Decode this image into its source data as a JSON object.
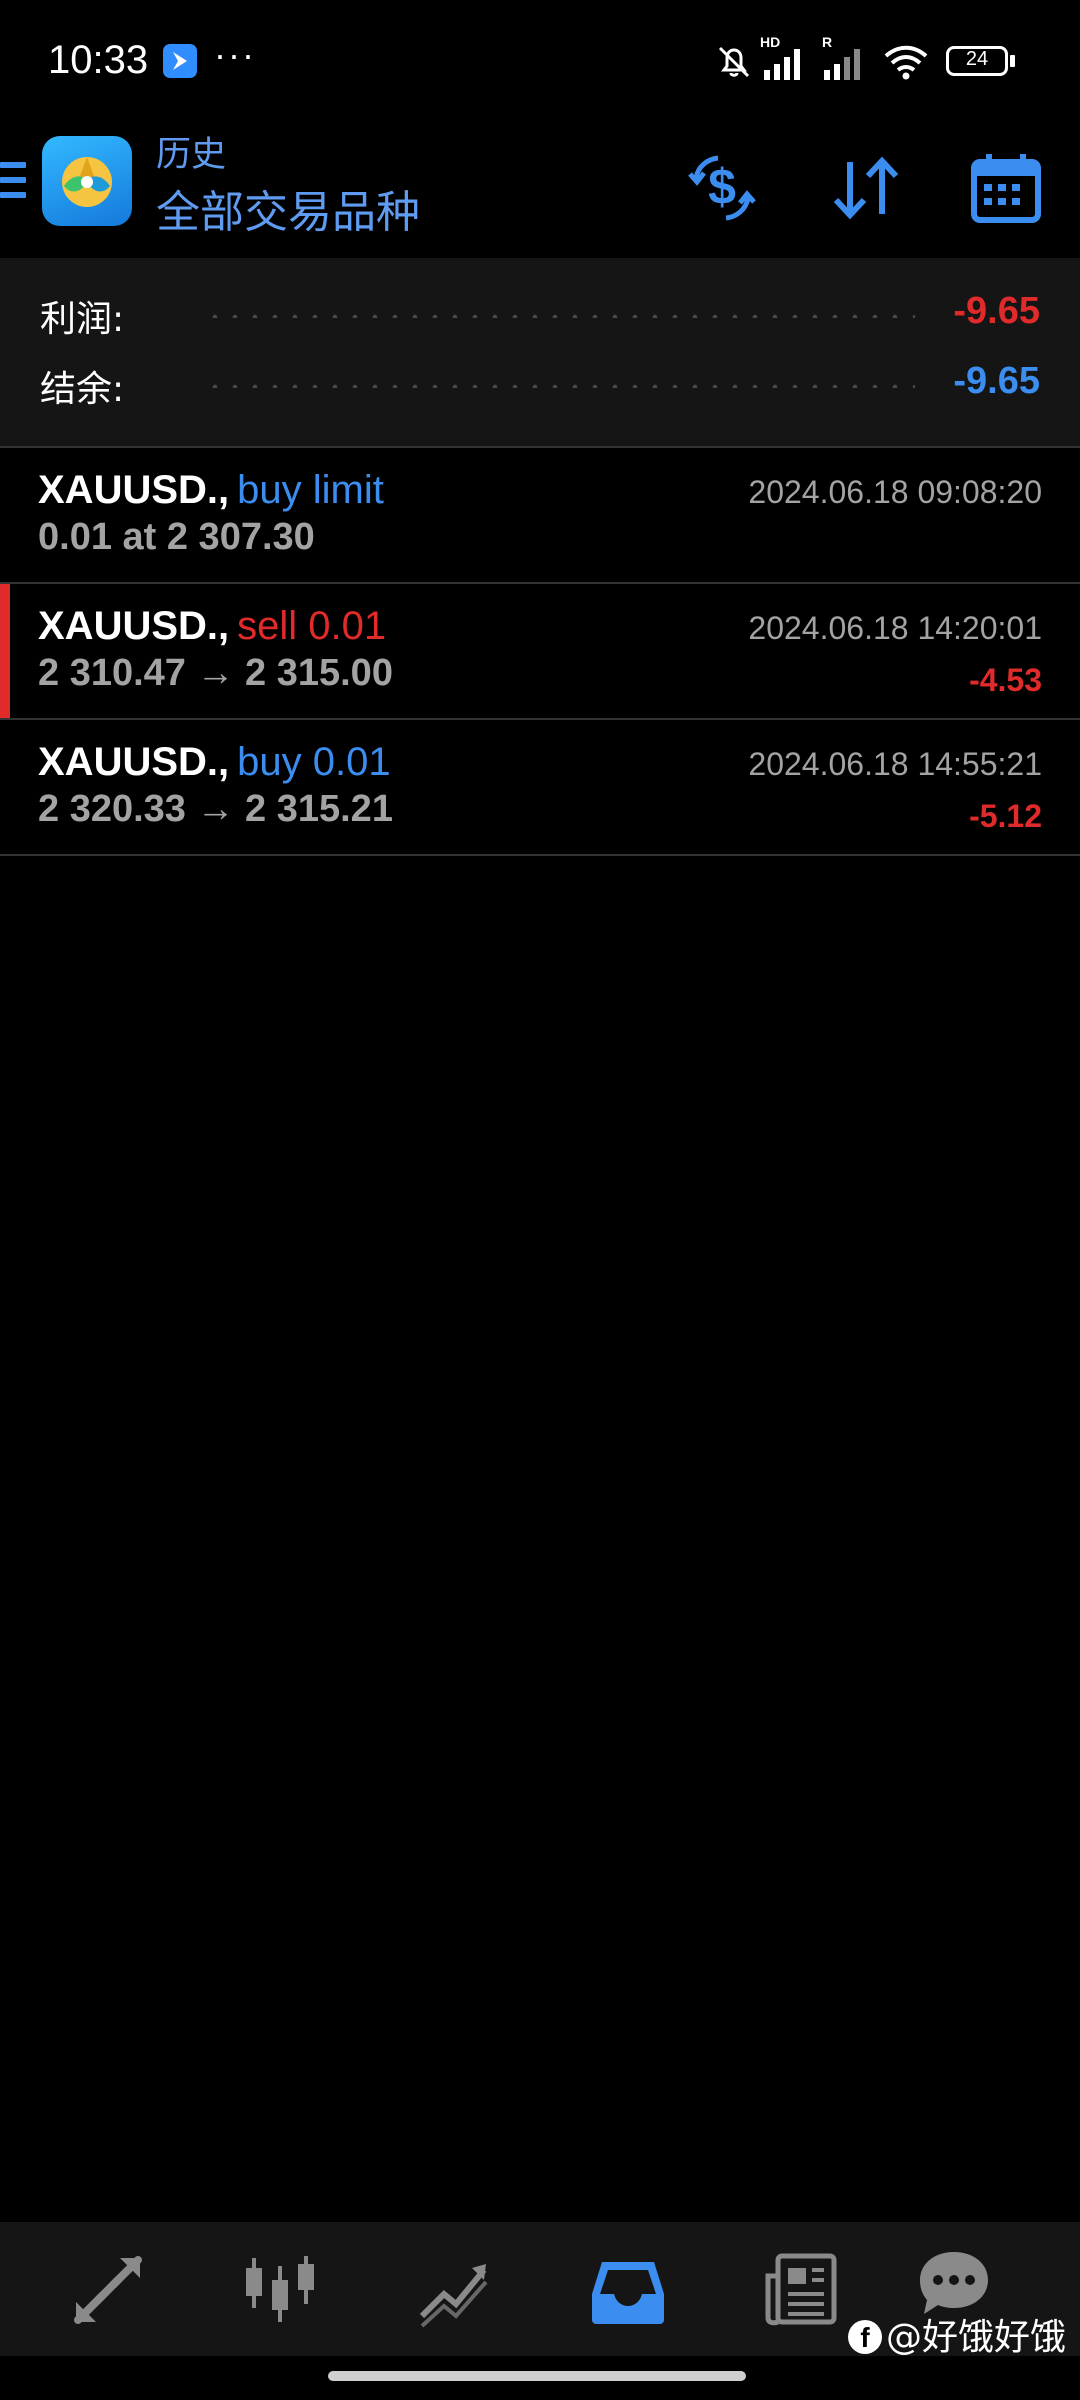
{
  "status_bar": {
    "time": "10:33",
    "more": "···",
    "network_hd": "HD",
    "network_r": "R",
    "battery": "24"
  },
  "toolbar": {
    "subtitle": "历史",
    "title": "全部交易品种"
  },
  "summary": {
    "profit_label": "利润:",
    "profit_value": "-9.65",
    "balance_label": "结余:",
    "balance_value": "-9.65"
  },
  "trades": [
    {
      "symbol": "XAUUSD.,",
      "type": "buy limit",
      "side": "buy",
      "detail": "0.01 at 2 307.30",
      "time": "2024.06.18 09:08:20",
      "pl": ""
    },
    {
      "symbol": "XAUUSD.,",
      "type": "sell 0.01",
      "side": "sell",
      "detail": "2 310.47 → 2 315.00",
      "time": "2024.06.18 14:20:01",
      "pl": "-4.53"
    },
    {
      "symbol": "XAUUSD.,",
      "type": "buy 0.01",
      "side": "buy",
      "detail": "2 320.33 → 2 315.21",
      "time": "2024.06.18 14:55:21",
      "pl": "-5.12"
    }
  ],
  "bottom_nav": {
    "icons": [
      "quotes-icon",
      "chart-icon",
      "trade-icon",
      "history-icon",
      "news-icon",
      "chat-icon"
    ],
    "active": "history-icon"
  },
  "watermark": {
    "prefix": "f",
    "text": "@好饿好饿"
  },
  "colors": {
    "accent_blue": "#3b8ef0",
    "loss_red": "#e12a2a",
    "text_gray": "#a3a3a3",
    "panel_bg": "#151515"
  }
}
